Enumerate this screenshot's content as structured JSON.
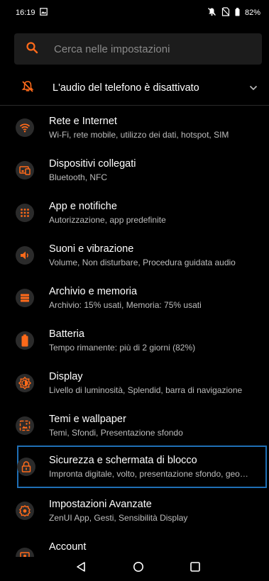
{
  "status_bar": {
    "time": "16:19",
    "battery": "82%"
  },
  "search": {
    "placeholder": "Cerca nelle impostazioni"
  },
  "muted_banner": {
    "text": "L'audio del telefono è disattivato"
  },
  "colors": {
    "accent": "#ff6a1a",
    "background": "#000000",
    "selection": "#1f6fb5"
  },
  "items": [
    {
      "title": "Rete e Internet",
      "subtitle": "Wi-Fi, rete mobile, utilizzo dei dati, hotspot, SIM",
      "icon": "wifi-icon"
    },
    {
      "title": "Dispositivi collegati",
      "subtitle": "Bluetooth, NFC",
      "icon": "devices-icon"
    },
    {
      "title": "App e notifiche",
      "subtitle": "Autorizzazione, app predefinite",
      "icon": "apps-grid-icon"
    },
    {
      "title": "Suoni e vibrazione",
      "subtitle": "Volume, Non disturbare, Procedura guidata audio",
      "icon": "volume-icon"
    },
    {
      "title": "Archivio e memoria",
      "subtitle": "Archivio: 15% usati, Memoria: 75% usati",
      "icon": "storage-icon"
    },
    {
      "title": "Batteria",
      "subtitle": "Tempo rimanente: più di 2 giorni (82%)",
      "icon": "battery-icon"
    },
    {
      "title": "Display",
      "subtitle": "Livello di luminosità, Splendid, barra di navigazione",
      "icon": "brightness-icon"
    },
    {
      "title": "Temi e wallpaper",
      "subtitle": "Temi, Sfondi, Presentazione sfondo",
      "icon": "wallpaper-icon"
    },
    {
      "title": "Sicurezza e schermata di blocco",
      "subtitle": "Impronta digitale, volto, presentazione sfondo, geo…",
      "icon": "lock-icon"
    },
    {
      "title": "Impostazioni Avanzate",
      "subtitle": "ZenUI App, Gesti, Sensibilità Display",
      "icon": "advanced-settings-icon"
    },
    {
      "title": "Account",
      "subtitle": "",
      "icon": "account-icon"
    }
  ]
}
